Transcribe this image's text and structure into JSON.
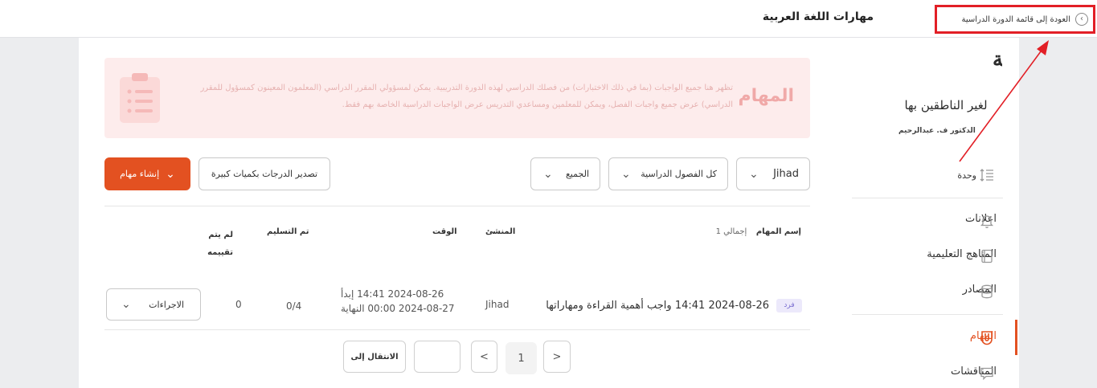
{
  "header": {
    "course_title": "مهارات اللغة العربية",
    "back_link": "العودة إلى قائمة الدورة الدراسية"
  },
  "banner": {
    "title": "المهام",
    "text": "تظهر هنا جميع الواجبات (بما في ذلك الاختبارات) من فصلك الدراسي لهذه الدورة التدريبية. يمكن لمسؤولي المقرر الدراسي (المعلمون المعينون كمسؤول للمقرر الدراسي) عرض جميع واجبات الفصل، ويمكن للمعلمين ومساعدي التدريس عرض الواجبات الدراسية الخاصة بهم فقط."
  },
  "toolbar": {
    "create_label": "إنشاء مهام",
    "export_label": "تصدير الدرجات بكميات كبيرة",
    "filter_all": "الجميع",
    "filter_classes": "كل الفصول الدراسية",
    "filter_teacher": "Jihad"
  },
  "table": {
    "headers": {
      "name": "إسم المهام",
      "total": "إجمالي 1",
      "creator": "المنشئ",
      "time": "الوقت",
      "submitted": "تم التسليم",
      "not_graded_line1": "لم يتم",
      "not_graded_line2": "تقييمه"
    },
    "rows": [
      {
        "badge": "فرد",
        "name": "2024-08-26 14:41 واجب أهمية القراءة ومهاراتها",
        "creator": "Jihad",
        "start": "2024-08-26 14:41 إبدأ",
        "end": "2024-08-27 00:00 النهاية",
        "submitted": "0/4",
        "not_graded": "0",
        "actions_label": "الاجراءات"
      }
    ]
  },
  "pagination": {
    "goto_label": "الانتقال إلى",
    "input_value": "",
    "prev": "<",
    "current": "1",
    "next": ">"
  },
  "sidebar": {
    "book_title": "دروس اللغة العربية",
    "book_subtitle": "لغير الناطقين بها",
    "book_author": "الدكتور ف. عبدالرحيم",
    "unit_label": "وحدة",
    "items": [
      {
        "label": "اعلانات",
        "icon": "bell-icon"
      },
      {
        "label": "المناهج التعليمية",
        "icon": "book-icon"
      },
      {
        "label": "المصادر",
        "icon": "database-icon"
      },
      {
        "label": "المهام",
        "icon": "badge-icon",
        "active": true
      },
      {
        "label": "المناقشات",
        "icon": "chat-icon"
      }
    ]
  },
  "colors": {
    "accent": "#e35121",
    "annotation": "#e21f26",
    "banner_bg": "#fdecec",
    "badge_bg": "#ece9fb"
  }
}
